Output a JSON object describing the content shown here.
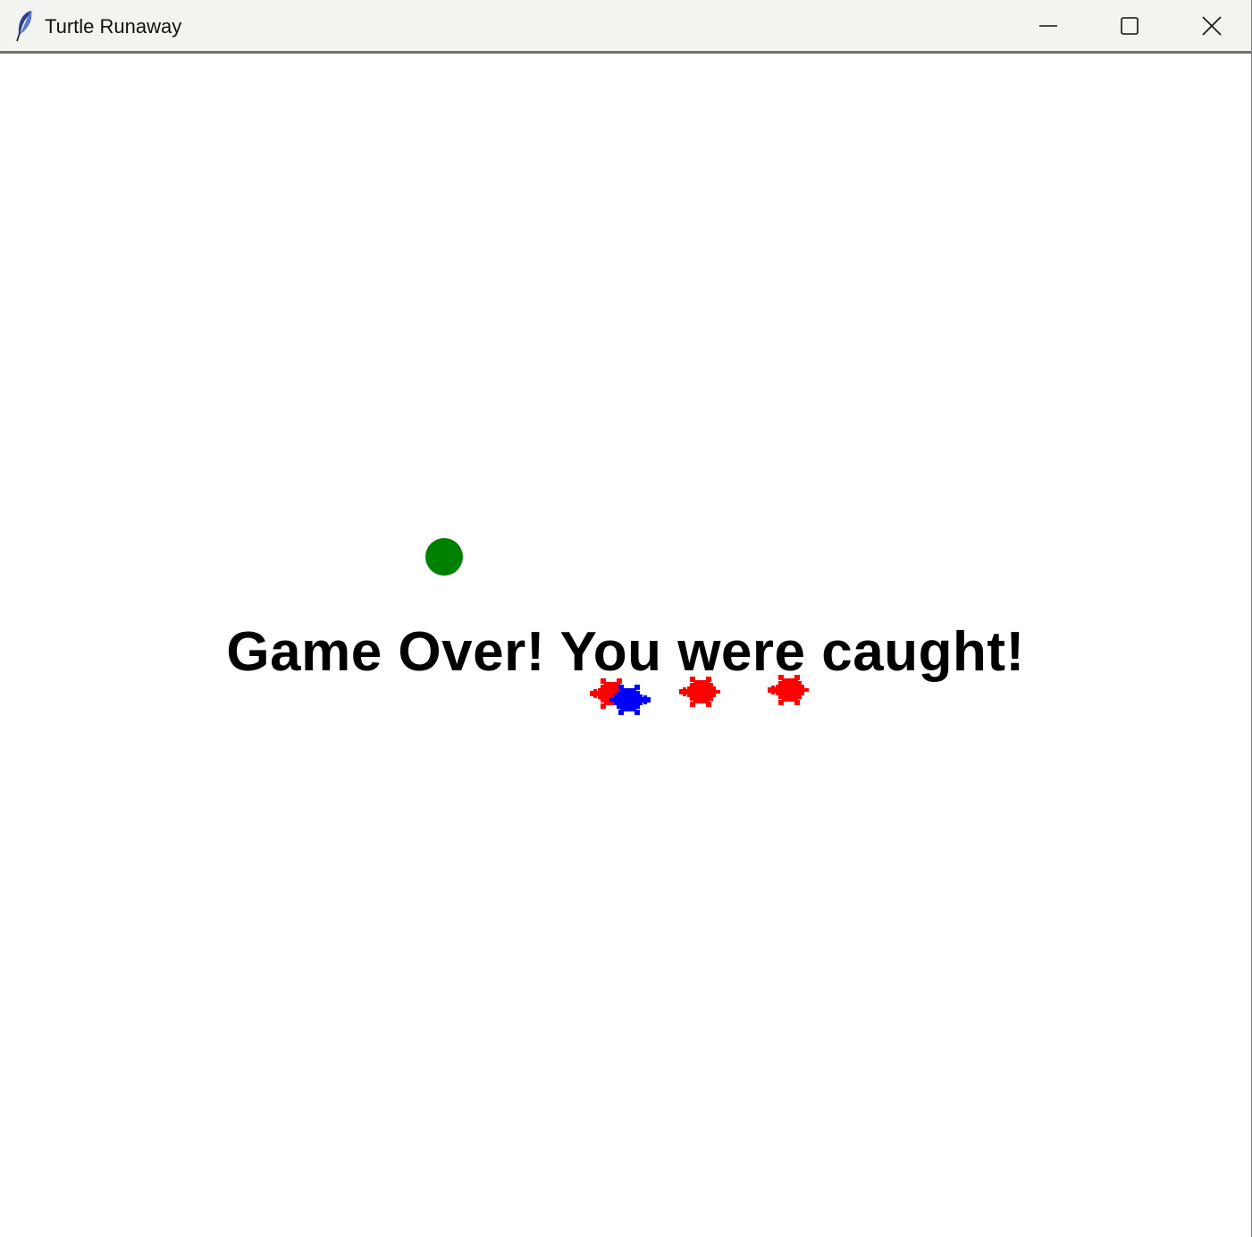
{
  "window": {
    "title": "Turtle Runaway",
    "app_icon": "feather-icon",
    "controls": {
      "minimize_icon": "minimize-icon",
      "maximize_icon": "maximize-icon",
      "close_icon": "close-icon"
    }
  },
  "game": {
    "message": "Game Over! You were caught!",
    "colors": {
      "target": "#008000",
      "player": "#0000ff",
      "chaser": "#ff0000",
      "text": "#000000",
      "background": "#ffffff"
    },
    "objects": {
      "target": "green-dot",
      "player": "blue-turtle",
      "chasers": [
        "red-turtle",
        "red-turtle",
        "red-turtle"
      ]
    }
  }
}
